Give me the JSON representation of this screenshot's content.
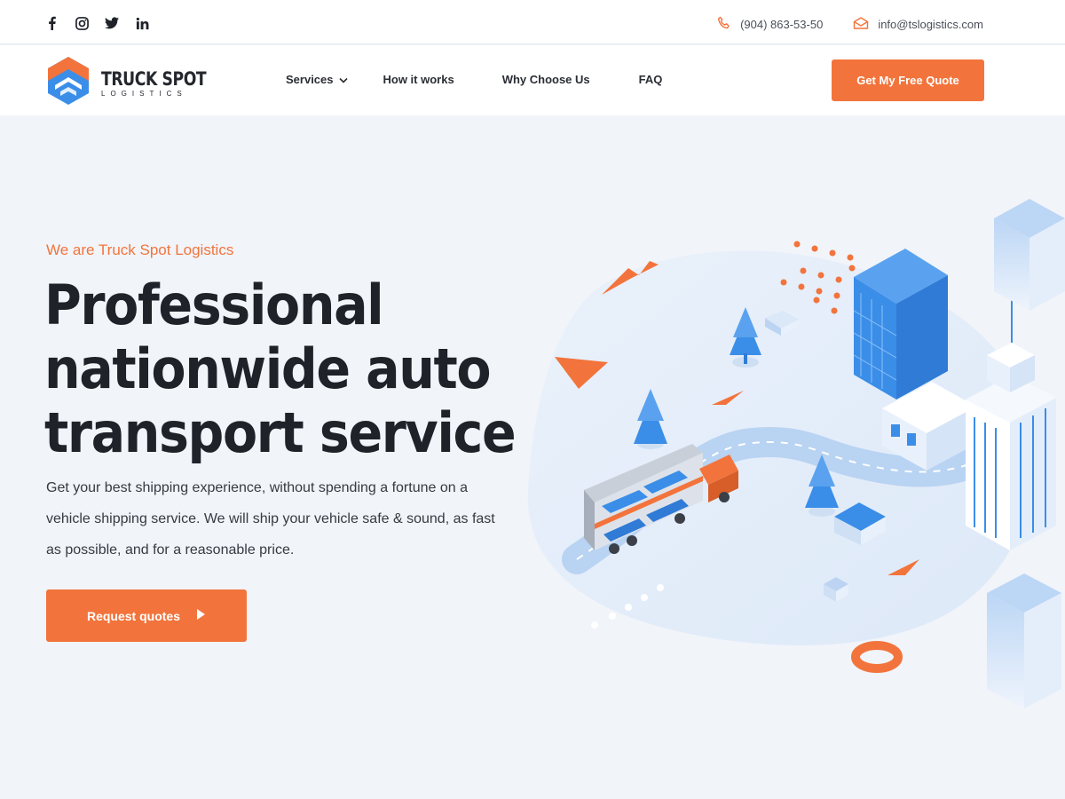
{
  "topbar": {
    "social_icons": [
      "facebook-icon",
      "instagram-icon",
      "twitter-icon",
      "linkedin-icon"
    ],
    "phone": "(904) 863-53-50",
    "email": "info@tslogistics.com"
  },
  "logo": {
    "name": "TRUCK SPOT",
    "sub": "LOGISTICS"
  },
  "nav": {
    "items": [
      {
        "label": "Services",
        "has_dropdown": true
      },
      {
        "label": "How it works"
      },
      {
        "label": "Why Choose Us"
      },
      {
        "label": "FAQ"
      }
    ],
    "cta_label": "Get My Free Quote"
  },
  "hero": {
    "tagline": "We are Truck Spot Logistics",
    "headline": [
      "Professional",
      "nationwide auto",
      "transport service"
    ],
    "description": "Get your best shipping experience, without spending a fortune on a vehicle shipping service. We will ship your vehicle safe & sound, as fast as possible, and for a reasonable price.",
    "button_label": "Request quotes"
  },
  "colors": {
    "accent": "#f2743c",
    "blue": "#3a8ee8",
    "background": "#f1f4f9",
    "text": "#1f2228"
  }
}
